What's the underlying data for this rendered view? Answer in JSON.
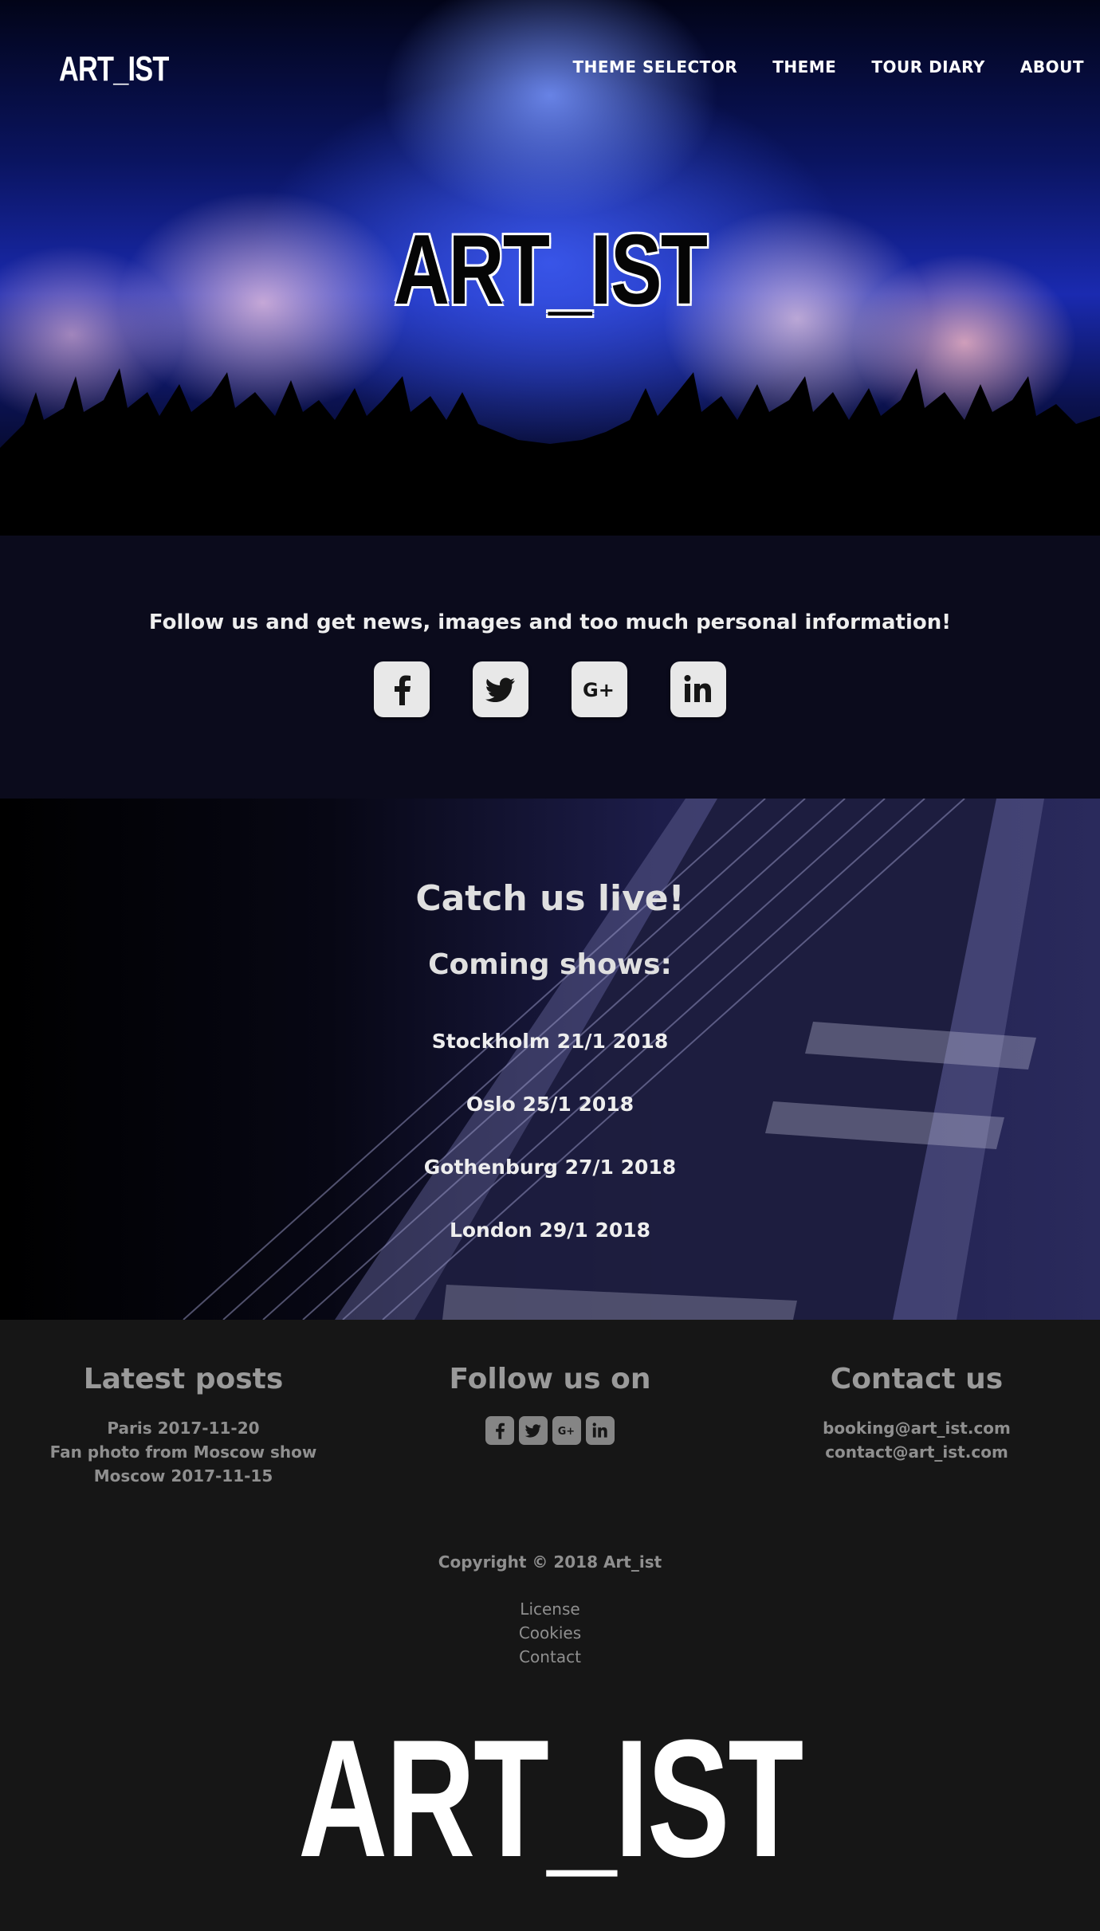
{
  "header": {
    "logo": "ART_IST",
    "nav": [
      "THEME SELECTOR",
      "THEME",
      "TOUR DIARY",
      "ABOUT"
    ]
  },
  "hero": {
    "title": "ART_IST"
  },
  "follow": {
    "text": "Follow us and get news, images and too much personal information!",
    "icons": [
      "facebook-icon",
      "twitter-icon",
      "google-plus-icon",
      "linkedin-icon"
    ]
  },
  "live": {
    "title": "Catch us live!",
    "subtitle": "Coming shows:",
    "shows": [
      "Stockholm 21/1 2018",
      "Oslo 25/1 2018",
      "Gothenburg 27/1 2018",
      "London 29/1 2018"
    ]
  },
  "footer": {
    "posts": {
      "title": "Latest posts",
      "items": [
        "Paris 2017-11-20",
        "Fan photo from Moscow show",
        "Moscow 2017-11-15"
      ]
    },
    "follow": {
      "title": "Follow us on"
    },
    "contact": {
      "title": "Contact us",
      "emails": [
        "booking@art_ist.com",
        "contact@art_ist.com"
      ]
    },
    "copyright": "Copyright © 2018 Art_ist",
    "legal": [
      "License",
      "Cookies",
      "Contact"
    ],
    "logo": "ART_IST"
  },
  "colors": {
    "section_dark": "#0b0b1c",
    "footer_bg": "#161616",
    "icon_bg": "#e8e8e8",
    "footer_text": "#8f8f8f"
  }
}
